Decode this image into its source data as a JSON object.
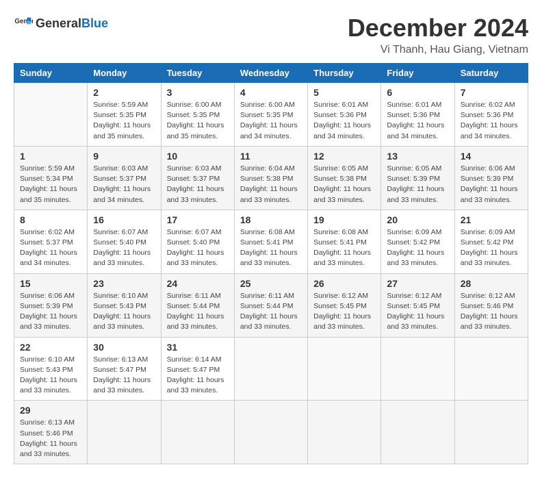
{
  "header": {
    "logo_general": "General",
    "logo_blue": "Blue",
    "month_title": "December 2024",
    "location": "Vi Thanh, Hau Giang, Vietnam"
  },
  "calendar": {
    "weekdays": [
      "Sunday",
      "Monday",
      "Tuesday",
      "Wednesday",
      "Thursday",
      "Friday",
      "Saturday"
    ],
    "weeks": [
      [
        {
          "day": "",
          "info": ""
        },
        {
          "day": "2",
          "info": "Sunrise: 5:59 AM\nSunset: 5:35 PM\nDaylight: 11 hours\nand 35 minutes."
        },
        {
          "day": "3",
          "info": "Sunrise: 6:00 AM\nSunset: 5:35 PM\nDaylight: 11 hours\nand 35 minutes."
        },
        {
          "day": "4",
          "info": "Sunrise: 6:00 AM\nSunset: 5:35 PM\nDaylight: 11 hours\nand 34 minutes."
        },
        {
          "day": "5",
          "info": "Sunrise: 6:01 AM\nSunset: 5:36 PM\nDaylight: 11 hours\nand 34 minutes."
        },
        {
          "day": "6",
          "info": "Sunrise: 6:01 AM\nSunset: 5:36 PM\nDaylight: 11 hours\nand 34 minutes."
        },
        {
          "day": "7",
          "info": "Sunrise: 6:02 AM\nSunset: 5:36 PM\nDaylight: 11 hours\nand 34 minutes."
        }
      ],
      [
        {
          "day": "1",
          "info": "Sunrise: 5:59 AM\nSunset: 5:34 PM\nDaylight: 11 hours\nand 35 minutes."
        },
        {
          "day": "9",
          "info": "Sunrise: 6:03 AM\nSunset: 5:37 PM\nDaylight: 11 hours\nand 34 minutes."
        },
        {
          "day": "10",
          "info": "Sunrise: 6:03 AM\nSunset: 5:37 PM\nDaylight: 11 hours\nand 33 minutes."
        },
        {
          "day": "11",
          "info": "Sunrise: 6:04 AM\nSunset: 5:38 PM\nDaylight: 11 hours\nand 33 minutes."
        },
        {
          "day": "12",
          "info": "Sunrise: 6:05 AM\nSunset: 5:38 PM\nDaylight: 11 hours\nand 33 minutes."
        },
        {
          "day": "13",
          "info": "Sunrise: 6:05 AM\nSunset: 5:39 PM\nDaylight: 11 hours\nand 33 minutes."
        },
        {
          "day": "14",
          "info": "Sunrise: 6:06 AM\nSunset: 5:39 PM\nDaylight: 11 hours\nand 33 minutes."
        }
      ],
      [
        {
          "day": "8",
          "info": "Sunrise: 6:02 AM\nSunset: 5:37 PM\nDaylight: 11 hours\nand 34 minutes."
        },
        {
          "day": "16",
          "info": "Sunrise: 6:07 AM\nSunset: 5:40 PM\nDaylight: 11 hours\nand 33 minutes."
        },
        {
          "day": "17",
          "info": "Sunrise: 6:07 AM\nSunset: 5:40 PM\nDaylight: 11 hours\nand 33 minutes."
        },
        {
          "day": "18",
          "info": "Sunrise: 6:08 AM\nSunset: 5:41 PM\nDaylight: 11 hours\nand 33 minutes."
        },
        {
          "day": "19",
          "info": "Sunrise: 6:08 AM\nSunset: 5:41 PM\nDaylight: 11 hours\nand 33 minutes."
        },
        {
          "day": "20",
          "info": "Sunrise: 6:09 AM\nSunset: 5:42 PM\nDaylight: 11 hours\nand 33 minutes."
        },
        {
          "day": "21",
          "info": "Sunrise: 6:09 AM\nSunset: 5:42 PM\nDaylight: 11 hours\nand 33 minutes."
        }
      ],
      [
        {
          "day": "15",
          "info": "Sunrise: 6:06 AM\nSunset: 5:39 PM\nDaylight: 11 hours\nand 33 minutes."
        },
        {
          "day": "23",
          "info": "Sunrise: 6:10 AM\nSunset: 5:43 PM\nDaylight: 11 hours\nand 33 minutes."
        },
        {
          "day": "24",
          "info": "Sunrise: 6:11 AM\nSunset: 5:44 PM\nDaylight: 11 hours\nand 33 minutes."
        },
        {
          "day": "25",
          "info": "Sunrise: 6:11 AM\nSunset: 5:44 PM\nDaylight: 11 hours\nand 33 minutes."
        },
        {
          "day": "26",
          "info": "Sunrise: 6:12 AM\nSunset: 5:45 PM\nDaylight: 11 hours\nand 33 minutes."
        },
        {
          "day": "27",
          "info": "Sunrise: 6:12 AM\nSunset: 5:45 PM\nDaylight: 11 hours\nand 33 minutes."
        },
        {
          "day": "28",
          "info": "Sunrise: 6:12 AM\nSunset: 5:46 PM\nDaylight: 11 hours\nand 33 minutes."
        }
      ],
      [
        {
          "day": "22",
          "info": "Sunrise: 6:10 AM\nSunset: 5:43 PM\nDaylight: 11 hours\nand 33 minutes."
        },
        {
          "day": "30",
          "info": "Sunrise: 6:13 AM\nSunset: 5:47 PM\nDaylight: 11 hours\nand 33 minutes."
        },
        {
          "day": "31",
          "info": "Sunrise: 6:14 AM\nSunset: 5:47 PM\nDaylight: 11 hours\nand 33 minutes."
        },
        {
          "day": "",
          "info": ""
        },
        {
          "day": "",
          "info": ""
        },
        {
          "day": "",
          "info": ""
        },
        {
          "day": "",
          "info": ""
        }
      ],
      [
        {
          "day": "29",
          "info": "Sunrise: 6:13 AM\nSunset: 5:46 PM\nDaylight: 11 hours\nand 33 minutes."
        },
        {
          "day": "",
          "info": ""
        },
        {
          "day": "",
          "info": ""
        },
        {
          "day": "",
          "info": ""
        },
        {
          "day": "",
          "info": ""
        },
        {
          "day": "",
          "info": ""
        },
        {
          "day": "",
          "info": ""
        }
      ]
    ]
  }
}
